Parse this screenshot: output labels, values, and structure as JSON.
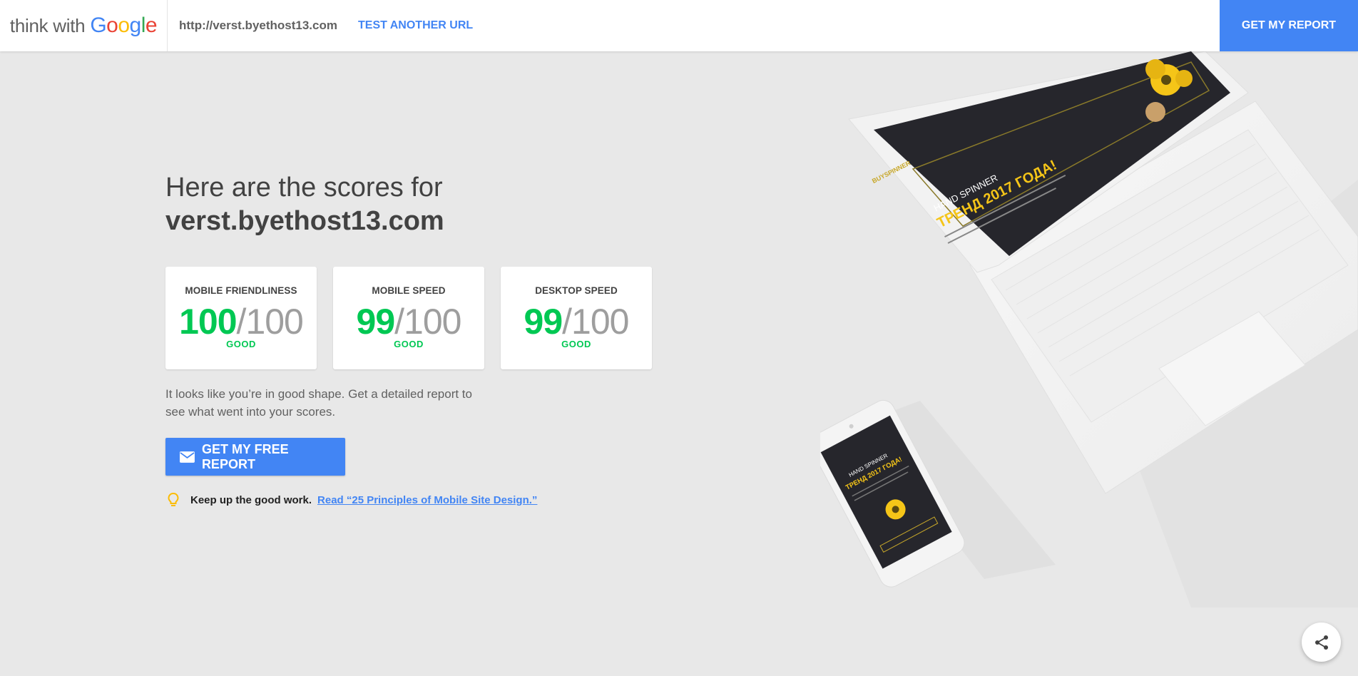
{
  "header": {
    "logo_think": "think with",
    "logo_google_letters": [
      "G",
      "o",
      "o",
      "g",
      "l",
      "e"
    ],
    "url": "http://verst.byethost13.com",
    "test_another": "TEST ANOTHER URL",
    "get_report": "GET MY REPORT"
  },
  "main": {
    "headline_intro": "Here are the scores for",
    "headline_domain": "verst.byethost13.com",
    "cards": [
      {
        "label": "MOBILE FRIENDLINESS",
        "score": "100",
        "max": "/100",
        "status": "GOOD"
      },
      {
        "label": "MOBILE SPEED",
        "score": "99",
        "max": "/100",
        "status": "GOOD"
      },
      {
        "label": "DESKTOP SPEED",
        "score": "99",
        "max": "/100",
        "status": "GOOD"
      }
    ],
    "message": "It looks like you’re in good shape. Get a detailed report to see what went into your scores.",
    "free_report_button": "GET MY FREE REPORT",
    "tip_bold": "Keep up the good work.",
    "tip_link": "Read “25 Principles of Mobile Site Design.”"
  },
  "illustration": {
    "laptop_screen_brand": "BUYSPINNER",
    "laptop_screen_line1": "HAND SPINNER",
    "laptop_screen_line2": "ТРЕНД 2017 ГОДА!",
    "phone_screen_line1": "HAND SPINNER",
    "phone_screen_line2": "ТРЕНД 2017 ГОДА!"
  },
  "colors": {
    "accent": "#4285f4",
    "good": "#00c853",
    "background": "#e8e8e8"
  },
  "icons": {
    "mail": "mail-icon",
    "bulb": "lightbulb-icon",
    "share": "share-icon"
  }
}
